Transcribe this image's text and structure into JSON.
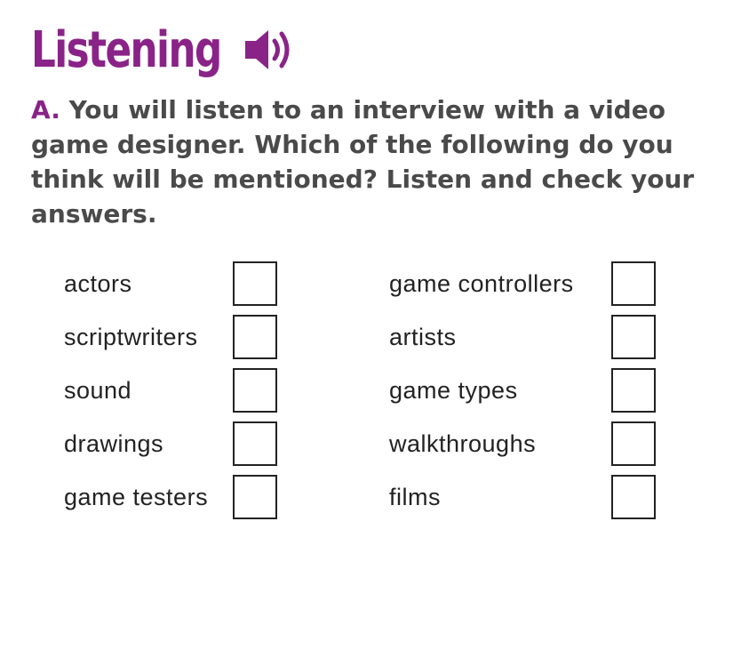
{
  "title": "Listening",
  "speaker_icon": "speaker-sound-icon",
  "exercise": {
    "letter": "A.",
    "text": "You will listen to an interview with a video game designer. Which of the following do you think will be mentioned? Listen and check your answers."
  },
  "colors": {
    "accent": "#8a2387",
    "text": "#4a4a4a"
  },
  "checklist": {
    "left": [
      {
        "label": "actors",
        "checked": false
      },
      {
        "label": "scriptwriters",
        "checked": false
      },
      {
        "label": "sound",
        "checked": false
      },
      {
        "label": "drawings",
        "checked": false
      },
      {
        "label": "game testers",
        "checked": false
      }
    ],
    "right": [
      {
        "label": "game controllers",
        "checked": false
      },
      {
        "label": "artists",
        "checked": false
      },
      {
        "label": "game types",
        "checked": false
      },
      {
        "label": "walkthroughs",
        "checked": false
      },
      {
        "label": "films",
        "checked": false
      }
    ]
  }
}
